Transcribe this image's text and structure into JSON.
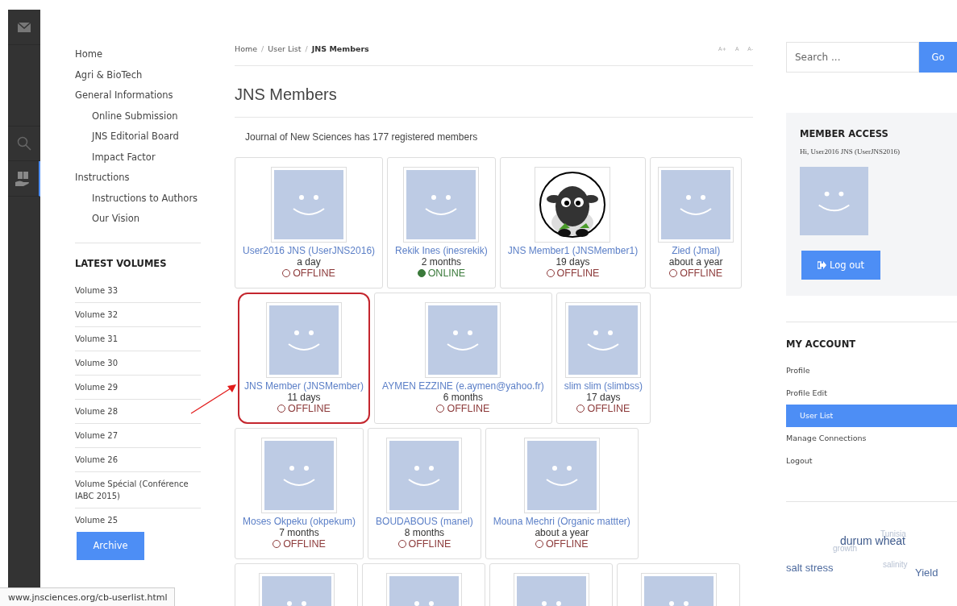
{
  "icon_rail": [
    {
      "kind": "mail",
      "selected": false
    },
    {
      "kind": "search",
      "selected": false
    },
    {
      "kind": "book",
      "selected": true
    }
  ],
  "nav": {
    "items": [
      {
        "label": "Home"
      },
      {
        "label": "Agri & BioTech"
      },
      {
        "label": "General Informations",
        "children": [
          {
            "label": "Online Submission"
          },
          {
            "label": "JNS Editorial Board"
          },
          {
            "label": "Impact Factor"
          }
        ]
      },
      {
        "label": "Instructions",
        "children": [
          {
            "label": "Instructions to Authors"
          },
          {
            "label": "Our Vision"
          }
        ]
      }
    ]
  },
  "latest_volumes": {
    "heading": "LATEST VOLUMES",
    "items": [
      "Volume 33",
      "Volume 32",
      "Volume 31",
      "Volume 30",
      "Volume 29",
      "Volume 28",
      "Volume 27",
      "Volume 26",
      "Volume Spécial (Conférence IABC 2015)",
      "Volume 25"
    ],
    "archive_button": "Archive"
  },
  "breadcrumb": [
    {
      "label": "Home"
    },
    {
      "separator": "/",
      "label": "User List"
    },
    {
      "separator": "/",
      "label": "JNS Members"
    }
  ],
  "font_size_controls": [
    "A+",
    "A",
    "A-"
  ],
  "title": "JNS Members",
  "member_count": "Journal of New Sciences has 177 registered members",
  "members": [
    {
      "kind": "default",
      "name": "User2016 JNS (UserJNS2016)",
      "last_seen": "a day",
      "status": "OFFLINE",
      "online": false,
      "highlighted": false
    },
    {
      "kind": "default",
      "name": "Rekik Ines (inesrekik)",
      "last_seen": "2 months",
      "status": "ONLINE",
      "online": true,
      "highlighted": false
    },
    {
      "kind": "sheep",
      "name": "JNS Member1 (JNSMember1)",
      "last_seen": "19 days",
      "status": "OFFLINE",
      "online": false,
      "highlighted": false
    },
    {
      "kind": "default",
      "name": "Zied (Jmal)",
      "last_seen": "about a year",
      "status": "OFFLINE",
      "online": false,
      "highlighted": false
    },
    {
      "kind": "default",
      "name": "JNS Member (JNSMember)",
      "last_seen": "11 days",
      "status": "OFFLINE",
      "online": false,
      "highlighted": true
    },
    {
      "kind": "default",
      "name": "AYMEN EZZINE (e.aymen@yahoo.fr)",
      "last_seen": "6 months",
      "status": "OFFLINE",
      "online": false,
      "highlighted": false
    },
    {
      "kind": "default",
      "name": "slim slim (slimbss)",
      "last_seen": "17 days",
      "status": "OFFLINE",
      "online": false,
      "highlighted": false
    },
    {
      "kind": "default",
      "name": "Moses Okpeku (okpekum)",
      "last_seen": "7 months",
      "status": "OFFLINE",
      "online": false,
      "highlighted": false
    },
    {
      "kind": "default",
      "name": "BOUDABOUS (manel)",
      "last_seen": "8 months",
      "status": "OFFLINE",
      "online": false,
      "highlighted": false
    },
    {
      "kind": "default",
      "name": "Mouna Mechri (Organic mattter)",
      "last_seen": "about a year",
      "status": "OFFLINE",
      "online": false,
      "highlighted": false
    }
  ],
  "partial_members": [
    {
      "kind": "default"
    },
    {
      "kind": "default"
    },
    {
      "kind": "default"
    },
    {
      "kind": "default"
    }
  ],
  "search": {
    "placeholder": "Search ...",
    "button": "Go"
  },
  "member_access": {
    "heading": "MEMBER ACCESS",
    "greeting": "Hi, User2016 JNS (UserJNS2016)",
    "logout_button": "Log out"
  },
  "my_account": {
    "heading": "MY ACCOUNT",
    "items": [
      {
        "label": "Profile",
        "selected": false
      },
      {
        "label": "Profile Edit",
        "selected": false
      },
      {
        "label": "User List",
        "selected": true
      },
      {
        "label": "Manage Connections",
        "selected": false
      },
      {
        "label": "Logout",
        "selected": false
      }
    ]
  },
  "tag_cloud": [
    {
      "text": "Tunisia",
      "kind": "faint"
    },
    {
      "text": "growth",
      "kind": "faint"
    },
    {
      "text": "durum wheat",
      "kind": "large"
    },
    {
      "text": "salt stress",
      "kind": "medium"
    },
    {
      "text": "salinity",
      "kind": "faint"
    },
    {
      "text": "Yield",
      "kind": "medium"
    }
  ],
  "status_url": "www.jnsciences.org/cb-userlist.html"
}
